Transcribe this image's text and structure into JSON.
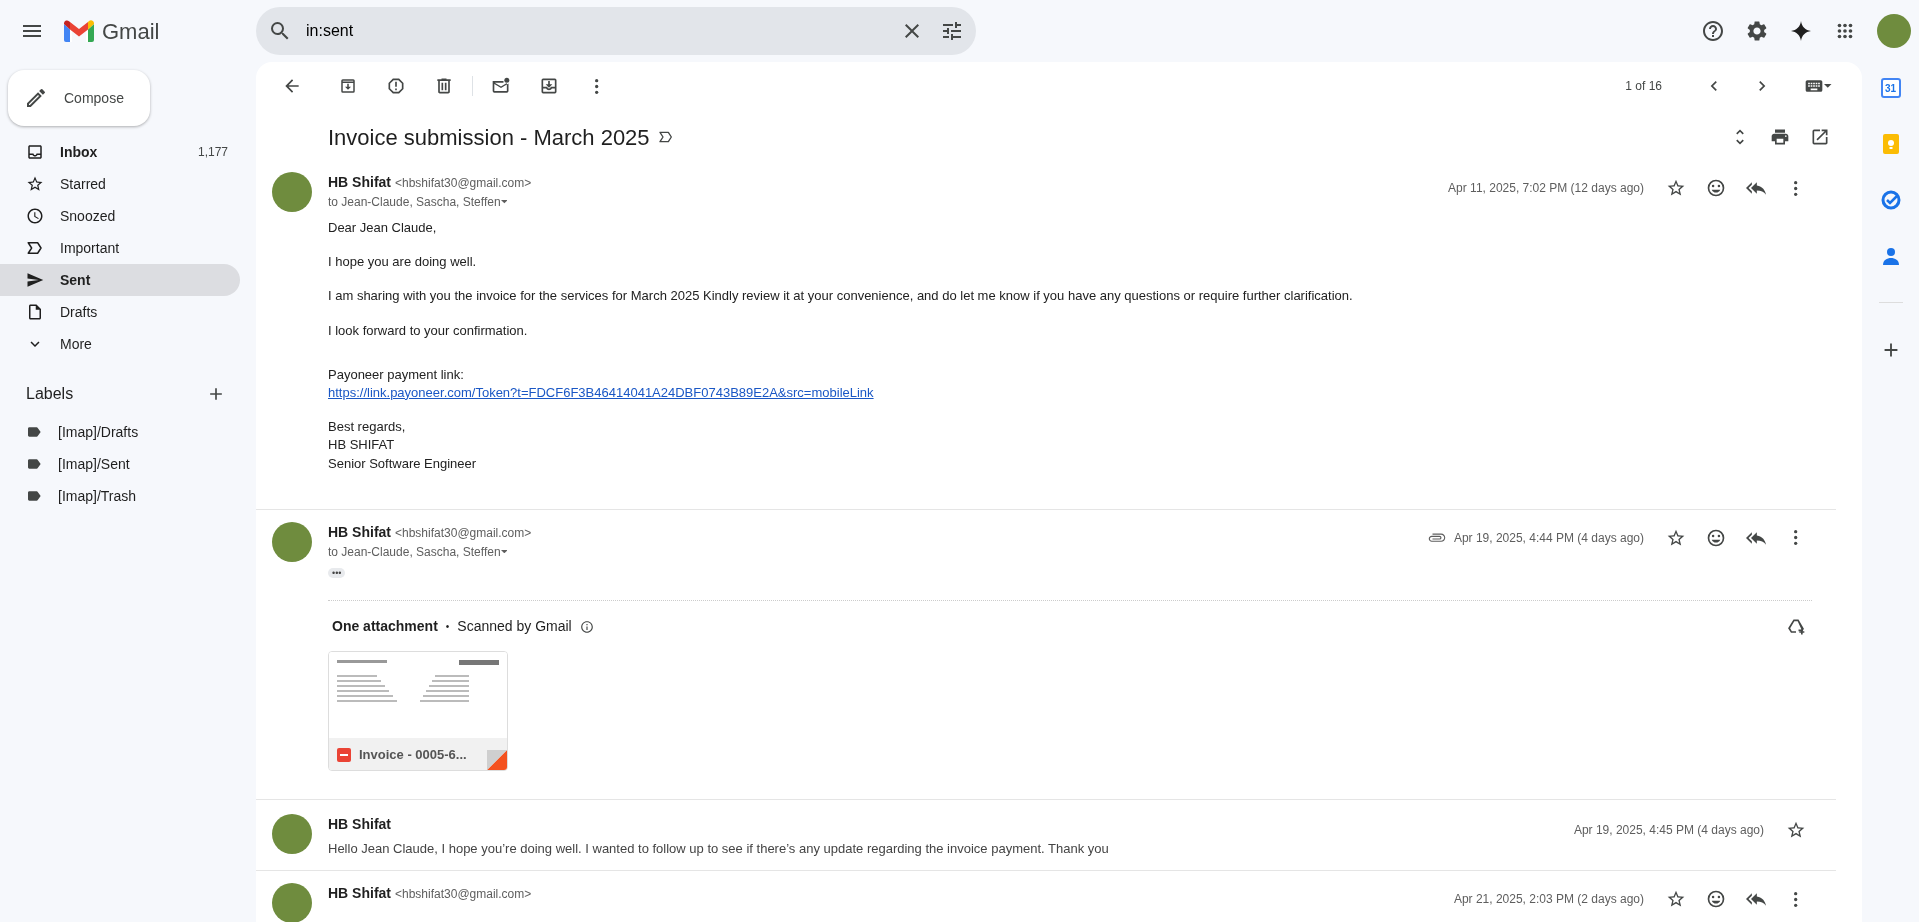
{
  "app": {
    "name": "Gmail"
  },
  "search": {
    "value": "in:sent"
  },
  "compose": {
    "label": "Compose"
  },
  "sidebar": {
    "items": [
      {
        "label": "Inbox",
        "count": "1,177",
        "unread": true,
        "selected": false
      },
      {
        "label": "Starred",
        "unread": false,
        "selected": false
      },
      {
        "label": "Snoozed",
        "unread": false,
        "selected": false
      },
      {
        "label": "Important",
        "unread": false,
        "selected": false
      },
      {
        "label": "Sent",
        "unread": false,
        "selected": true
      },
      {
        "label": "Drafts",
        "unread": false,
        "selected": false
      },
      {
        "label": "More",
        "unread": false,
        "selected": false
      }
    ]
  },
  "labels": {
    "title": "Labels",
    "items": [
      {
        "label": "[Imap]/Drafts"
      },
      {
        "label": "[Imap]/Sent"
      },
      {
        "label": "[Imap]/Trash"
      }
    ]
  },
  "toolbar": {
    "pager": "1 of 16"
  },
  "side_panel": {
    "calendar_day": "31"
  },
  "thread": {
    "subject": "Invoice submission - March 2025",
    "messages": [
      {
        "kind": "expanded",
        "sender": "HB Shifat",
        "email": "<hbshifat30@gmail.com>",
        "to": "to Jean-Claude, Sascha, Steffen",
        "date": "Apr 11, 2025, 7:02 PM (12 days ago)",
        "paragraphs": [
          {
            "lines": [
              "Dear Jean Claude,"
            ]
          },
          {
            "lines": [
              "I hope you are doing well."
            ]
          },
          {
            "lines": [
              "I am sharing with you the invoice for the services for March 2025 Kindly review it at your convenience, and do let me know if you have any questions or require further clarification."
            ]
          },
          {
            "lines": [
              "I look forward to your confirmation."
            ]
          },
          {
            "lines": [
              "Payoneer payment link:"
            ],
            "link": "https://link.payoneer.com/Token?t=FDCF6F3B46414041A24DBF0743B89E2A&src=mobileLink"
          },
          {
            "lines": [
              "Best regards,",
              "HB SHIFAT",
              "Senior Software Engineer"
            ]
          }
        ]
      },
      {
        "kind": "expanded",
        "sender": "HB Shifat",
        "email": "<hbshifat30@gmail.com>",
        "to": "to Jean-Claude, Sascha, Steffen",
        "date": "Apr 19, 2025, 4:44 PM (4 days ago)",
        "trimmed": "•••",
        "attachments": {
          "title": "One attachment",
          "separator": "•",
          "scan": "Scanned by Gmail",
          "files": [
            {
              "name": "Invoice - 0005-6..."
            }
          ]
        }
      },
      {
        "kind": "collapsed",
        "sender": "HB Shifat",
        "snippet": "Hello Jean Claude, I hope you’re doing well. I wanted to follow up to see if there’s any update regarding the invoice payment. Thank you",
        "date": "Apr 19, 2025, 4:45 PM (4 days ago)"
      },
      {
        "kind": "expanded",
        "sender": "HB Shifat",
        "email": "<hbshifat30@gmail.com>",
        "date": "Apr 21, 2025, 2:03 PM (2 days ago)"
      }
    ]
  }
}
